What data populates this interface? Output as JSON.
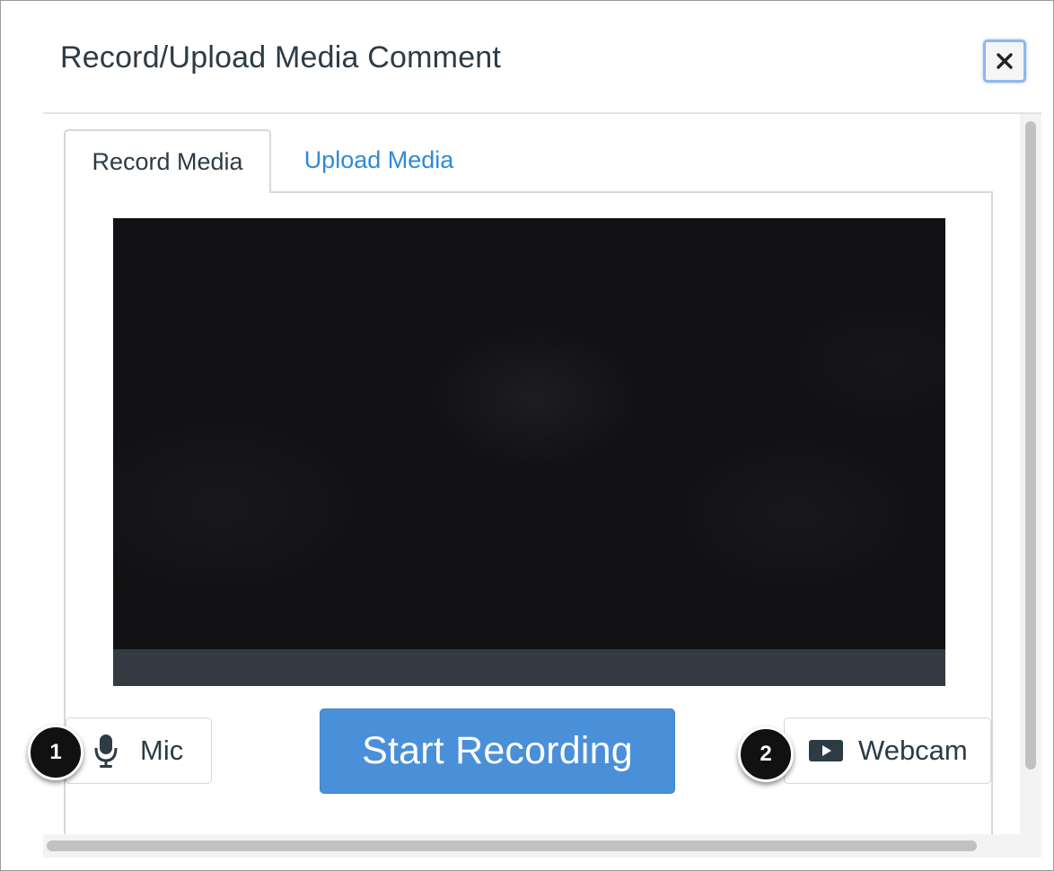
{
  "dialog": {
    "title": "Record/Upload Media Comment",
    "close_icon": "close-icon"
  },
  "tabs": [
    {
      "label": "Record Media",
      "selected": true
    },
    {
      "label": "Upload Media",
      "selected": false
    }
  ],
  "controls": {
    "mic_label": "Mic",
    "mic_icon": "microphone-icon",
    "start_label": "Start Recording",
    "webcam_label": "Webcam",
    "webcam_icon": "video-camera-icon"
  },
  "callouts": [
    "1",
    "2"
  ],
  "colors": {
    "accent": "#4a90d9",
    "link": "#2e8ad8",
    "text": "#2d3b45",
    "video_bg": "#111113",
    "video_bar": "#343a42"
  }
}
